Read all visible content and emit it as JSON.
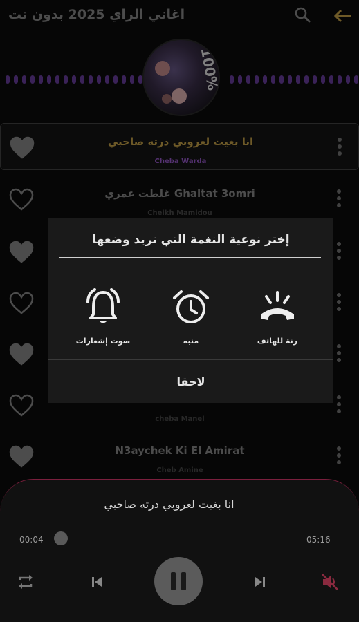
{
  "app": {
    "title": "اغاني الراي 2025 بدون نت"
  },
  "icons": {
    "back": "arrow-left-icon",
    "search": "search-icon",
    "heart": "heart-icon",
    "more": "kebab-menu-icon"
  },
  "colors": {
    "accent_gold": "#c9a44a",
    "accent_purple": "#9c5bd0",
    "visualizer": "#6b3fa0",
    "player_border": "#7a1f3d"
  },
  "songs": [
    {
      "title": "انا بغيت لعروبي درته صاحبي",
      "artist": "Cheba Warda",
      "selected": true,
      "favorite": true
    },
    {
      "title": "غلطت عمري Ghaltat 3omri",
      "artist": "Cheikh Mamidou",
      "selected": false,
      "favorite": false
    },
    {
      "title": "",
      "artist": "",
      "selected": false,
      "favorite": true
    },
    {
      "title": "",
      "artist": "",
      "selected": false,
      "favorite": false
    },
    {
      "title": "",
      "artist": "",
      "selected": false,
      "favorite": true
    },
    {
      "title": "",
      "artist": "cheba Manel",
      "selected": false,
      "favorite": false
    },
    {
      "title": "N3aychek Ki El Amirat",
      "artist": "Cheb Amine",
      "selected": false,
      "favorite": true
    }
  ],
  "dialog": {
    "title": "إختر نوعية النغمة التي تريد وضعها",
    "options": [
      {
        "label": "صوت إشعارات",
        "icon": "notification-bell-icon"
      },
      {
        "label": "منبه",
        "icon": "alarm-clock-icon"
      },
      {
        "label": "رنة للهاتف",
        "icon": "phone-ringtone-icon"
      }
    ],
    "later_label": "لاحقا"
  },
  "player": {
    "title": "انا بغيت لعروبي درته صاحبي",
    "current_time": "00:04",
    "total_time": "05:16",
    "progress": 0.013,
    "playing": true,
    "muted": true,
    "icons": {
      "repeat": "repeat-icon",
      "prev": "skip-previous-icon",
      "pause": "pause-icon",
      "next": "skip-next-icon",
      "mute": "volume-off-icon"
    }
  }
}
